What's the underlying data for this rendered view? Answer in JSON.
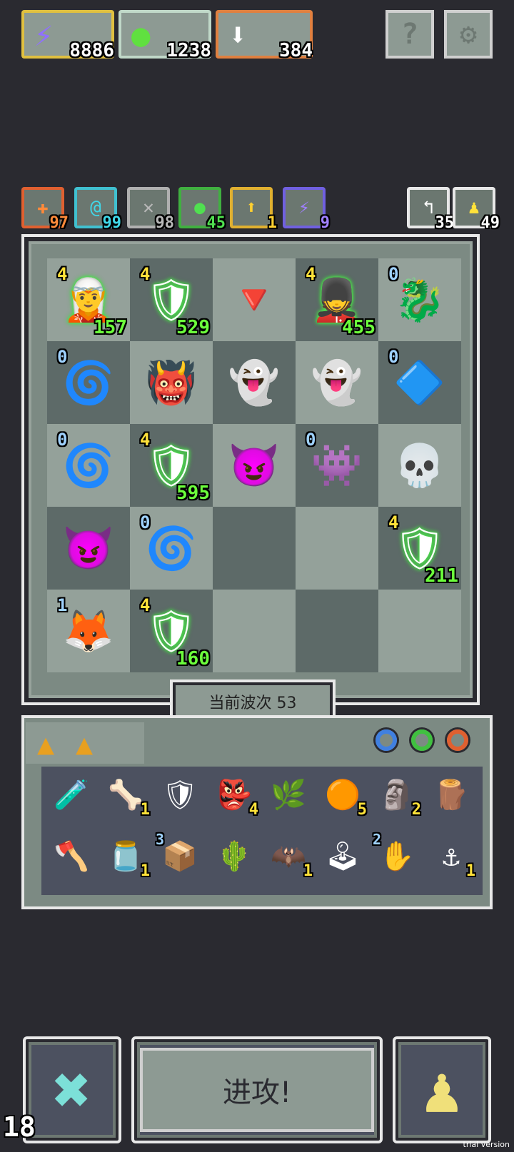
{
  "resources": [
    {
      "name": "energy",
      "icon": "lightning-icon",
      "glyph": "⚡",
      "value": "8886",
      "color": "#e0c040"
    },
    {
      "name": "gems",
      "icon": "green-orb-icon",
      "glyph": "●",
      "value": "1238",
      "color": "#c0d8c8"
    },
    {
      "name": "arrows",
      "icon": "down-arrow-icon",
      "glyph": "⬇",
      "value": "384",
      "color": "#e08040"
    }
  ],
  "buttons": {
    "help": "?",
    "settings": "⚙"
  },
  "buffs": [
    {
      "icon": "plus-icon",
      "glyph": "✚",
      "value": "97",
      "border": "#e06030",
      "color": "#ff8a3a"
    },
    {
      "icon": "at-icon",
      "glyph": "@",
      "value": "99",
      "border": "#40c0d0",
      "color": "#40d8e8"
    },
    {
      "icon": "cross-swords-icon",
      "glyph": "✕",
      "value": "98",
      "border": "#b0b0b0",
      "color": "#b8b8b8"
    },
    {
      "icon": "green-drop-icon",
      "glyph": "●",
      "value": "45",
      "border": "#40b040",
      "color": "#50e050"
    },
    {
      "icon": "up-arrow-icon",
      "glyph": "⬆",
      "value": "1",
      "border": "#e0b030",
      "color": "#ffd030"
    },
    {
      "icon": "lightning-icon",
      "glyph": "⚡",
      "value": "9",
      "border": "#7060e0",
      "color": "#a080ff"
    }
  ],
  "counters": [
    {
      "icon": "return-icon",
      "glyph": "↰",
      "value": "35"
    },
    {
      "icon": "pawn-icon",
      "glyph": "♟",
      "value": "49"
    }
  ],
  "board": [
    [
      {
        "name": "catgirl-archer",
        "glyph": "🧝",
        "level": "4",
        "hp": "157",
        "glow": true,
        "tone": "y"
      },
      {
        "name": "shield-knight",
        "glyph": "🛡",
        "level": "4",
        "hp": "529",
        "glow": true,
        "tone": "y"
      },
      {
        "name": "red-crystal",
        "glyph": "🔻",
        "level": "",
        "hp": "",
        "glow": false,
        "tone": "y"
      },
      {
        "name": "armored-soldier",
        "glyph": "💂",
        "level": "4",
        "hp": "455",
        "glow": true,
        "tone": "y"
      },
      {
        "name": "purple-dragon",
        "glyph": "🐉",
        "level": "0",
        "hp": "",
        "glow": false,
        "tone": "b"
      }
    ],
    [
      {
        "name": "purple-wraith",
        "glyph": "🌀",
        "level": "0",
        "hp": "",
        "glow": false,
        "tone": "b"
      },
      {
        "name": "green-golem",
        "glyph": "👹",
        "level": "",
        "hp": "",
        "glow": false,
        "tone": "y"
      },
      {
        "name": "white-yeti",
        "glyph": "👻",
        "level": "",
        "hp": "",
        "glow": false,
        "tone": "y"
      },
      {
        "name": "white-yeti",
        "glyph": "👻",
        "level": "",
        "hp": "",
        "glow": false,
        "tone": "y"
      },
      {
        "name": "blue-banner",
        "glyph": "🔷",
        "level": "0",
        "hp": "",
        "glow": false,
        "tone": "b"
      }
    ],
    [
      {
        "name": "purple-wraith",
        "glyph": "🌀",
        "level": "0",
        "hp": "",
        "glow": false,
        "tone": "b"
      },
      {
        "name": "shield-knight",
        "glyph": "🛡",
        "level": "4",
        "hp": "595",
        "glow": true,
        "tone": "y"
      },
      {
        "name": "purple-demon",
        "glyph": "😈",
        "level": "",
        "hp": "",
        "glow": false,
        "tone": "y"
      },
      {
        "name": "pink-demon",
        "glyph": "👾",
        "level": "0",
        "hp": "",
        "glow": false,
        "tone": "b"
      },
      {
        "name": "skull-beast",
        "glyph": "💀",
        "level": "",
        "hp": "",
        "glow": false,
        "tone": "y"
      }
    ],
    [
      {
        "name": "purple-demon",
        "glyph": "😈",
        "level": "",
        "hp": "",
        "glow": false,
        "tone": "y"
      },
      {
        "name": "purple-wraith",
        "glyph": "🌀",
        "level": "0",
        "hp": "",
        "glow": false,
        "tone": "b"
      },
      {
        "name": "empty",
        "glyph": "",
        "level": "",
        "hp": "",
        "glow": false,
        "tone": "y"
      },
      {
        "name": "empty",
        "glyph": "",
        "level": "",
        "hp": "",
        "glow": false,
        "tone": "y"
      },
      {
        "name": "shield-knight",
        "glyph": "🛡",
        "level": "4",
        "hp": "211",
        "glow": true,
        "tone": "y"
      }
    ],
    [
      {
        "name": "fox-mage",
        "glyph": "🦊",
        "level": "1",
        "hp": "",
        "glow": false,
        "tone": "b"
      },
      {
        "name": "shield-knight",
        "glyph": "🛡",
        "level": "4",
        "hp": "160",
        "glow": true,
        "tone": "y"
      },
      {
        "name": "empty",
        "glyph": "",
        "level": "",
        "hp": "",
        "glow": false,
        "tone": "y"
      },
      {
        "name": "empty",
        "glyph": "",
        "level": "",
        "hp": "",
        "glow": false,
        "tone": "y"
      },
      {
        "name": "empty",
        "glyph": "",
        "level": "",
        "hp": "",
        "glow": false,
        "tone": "y"
      }
    ]
  ],
  "wave_label": "当前波次 53",
  "inventory_tabs": [
    "▲",
    "▲"
  ],
  "rings": [
    {
      "icon": "blue-ring-icon",
      "color": "#4080e0"
    },
    {
      "icon": "green-ring-icon",
      "color": "#40c040"
    },
    {
      "icon": "orange-ring-icon",
      "color": "#e06030"
    }
  ],
  "inventory": [
    [
      {
        "icon": "green-potion-icon",
        "glyph": "🧪",
        "count": "",
        "level": ""
      },
      {
        "icon": "bone-icon",
        "glyph": "🦴",
        "count": "1",
        "level": ""
      },
      {
        "icon": "shield-icon",
        "glyph": "🛡",
        "count": "",
        "level": ""
      },
      {
        "icon": "red-mask-icon",
        "glyph": "👺",
        "count": "4",
        "level": ""
      },
      {
        "icon": "vine-tile-icon",
        "glyph": "🌿",
        "count": "",
        "level": ""
      },
      {
        "icon": "orange-orb-icon",
        "glyph": "🟠",
        "count": "5",
        "level": ""
      },
      {
        "icon": "totem-icon",
        "glyph": "🗿",
        "count": "2",
        "level": ""
      },
      {
        "icon": "stick-icon",
        "glyph": "🪵",
        "count": "",
        "level": ""
      }
    ],
    [
      {
        "icon": "purple-axe-icon",
        "glyph": "🪓",
        "count": "",
        "level": ""
      },
      {
        "icon": "purple-potion-icon",
        "glyph": "🫙",
        "count": "1",
        "level": ""
      },
      {
        "icon": "gear-box-icon",
        "glyph": "📦",
        "count": "",
        "level": "3"
      },
      {
        "icon": "spike-plant-icon",
        "glyph": "🌵",
        "count": "",
        "level": ""
      },
      {
        "icon": "bat-orb-icon",
        "glyph": "🦇",
        "count": "1",
        "level": ""
      },
      {
        "icon": "lever-icon",
        "glyph": "🕹",
        "count": "",
        "level": ""
      },
      {
        "icon": "eye-hand-icon",
        "glyph": "✋",
        "count": "",
        "level": "2"
      },
      {
        "icon": "anchor-icon",
        "glyph": "⚓",
        "count": "1",
        "level": ""
      }
    ]
  ],
  "bottom": {
    "cancel_glyph": "✖",
    "attack_label": "进攻!",
    "pawn_glyph": "♟",
    "corner_counter": "18"
  },
  "watermark": "trial version"
}
